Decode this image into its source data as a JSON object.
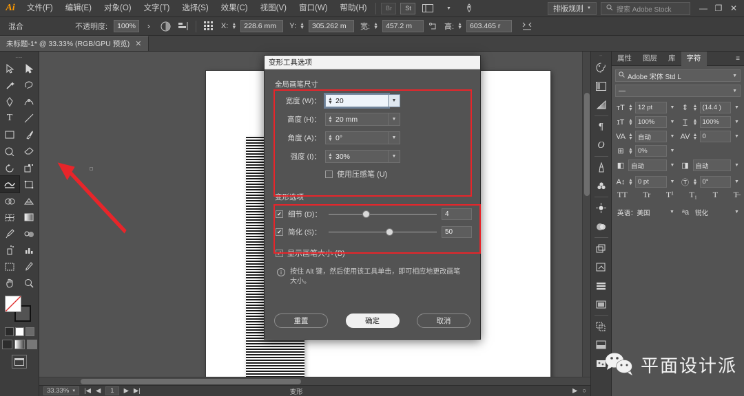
{
  "menubar": {
    "logo": "Ai",
    "items": [
      {
        "label": "文件(F)"
      },
      {
        "label": "编辑(E)"
      },
      {
        "label": "对象(O)"
      },
      {
        "label": "文字(T)"
      },
      {
        "label": "选择(S)"
      },
      {
        "label": "效果(C)"
      },
      {
        "label": "视图(V)"
      },
      {
        "label": "窗口(W)"
      },
      {
        "label": "帮助(H)"
      }
    ],
    "bridge_badge": "Br",
    "stock_badge": "St",
    "library_icon": "library-icon",
    "rocket_icon": "rocket-icon",
    "workspace": "排版规则",
    "search_placeholder": "搜索 Adobe Stock",
    "minimize": "—",
    "maximize": "❐",
    "close": "✕"
  },
  "controlbar": {
    "mode_label": "混合",
    "opacity_label": "不透明度:",
    "opacity_value": "100%",
    "arrow": "›",
    "transparency_icon": "transparency-icon",
    "align_icon": "align-icon",
    "anchor_icon": "anchor-reference-icon",
    "x_label": "X:",
    "x_value": "228.6 mm",
    "y_label": "Y:",
    "y_value": "305.262 m",
    "w_label": "宽:",
    "w_value": "457.2 m",
    "lock_icon": "link-ratio-icon",
    "h_label": "高:",
    "h_value": "603.465 r",
    "transform_icon": "transform-icon"
  },
  "doctab": {
    "title": "未标题-1* @ 33.33% (RGB/GPU 预览)",
    "close": "✕"
  },
  "toolbar": {
    "tools": [
      {
        "name": "selection-tool"
      },
      {
        "name": "direct-selection-tool"
      },
      {
        "name": "magic-wand-tool"
      },
      {
        "name": "lasso-tool"
      },
      {
        "name": "pen-tool"
      },
      {
        "name": "curvature-tool"
      },
      {
        "name": "type-tool"
      },
      {
        "name": "line-segment-tool"
      },
      {
        "name": "rectangle-tool"
      },
      {
        "name": "paintbrush-tool"
      },
      {
        "name": "shaper-tool"
      },
      {
        "name": "eraser-tool"
      },
      {
        "name": "rotate-tool"
      },
      {
        "name": "scale-tool"
      },
      {
        "name": "warp-tool"
      },
      {
        "name": "free-transform-tool"
      },
      {
        "name": "shape-builder-tool"
      },
      {
        "name": "perspective-grid-tool"
      },
      {
        "name": "mesh-tool"
      },
      {
        "name": "gradient-tool"
      },
      {
        "name": "eyedropper-tool"
      },
      {
        "name": "blend-tool"
      },
      {
        "name": "symbol-sprayer-tool"
      },
      {
        "name": "column-graph-tool"
      },
      {
        "name": "artboard-tool"
      },
      {
        "name": "slice-tool"
      },
      {
        "name": "hand-tool"
      },
      {
        "name": "zoom-tool"
      }
    ],
    "active_tool": "warp-tool",
    "fill_color": "#ffffff",
    "stroke_color": "#000000",
    "screen_mode": "screen-mode-icon"
  },
  "canvas": {
    "artboard_bg": "#ffffff",
    "stripe_dark": "#1a1a1a",
    "annotation_color": "#e8252a"
  },
  "statusbar": {
    "zoom": "33.33%",
    "nav_first": "|◀",
    "nav_prev": "◀",
    "page_value": "1",
    "nav_next": "▶",
    "nav_last": "▶|",
    "tool_label": "变形",
    "play": "▶",
    "circle": "○"
  },
  "rail": {
    "icons": [
      {
        "name": "color-panel-icon"
      },
      {
        "name": "color-guide-icon"
      },
      {
        "name": "gradient-panel-icon"
      },
      {
        "name": "paragraph-panel-icon"
      },
      {
        "name": "opentype-panel-icon"
      },
      {
        "name": "brushes-panel-icon"
      },
      {
        "name": "symbols-panel-icon"
      },
      {
        "name": "appearance-panel-icon"
      },
      {
        "name": "graphic-styles-icon"
      },
      {
        "name": "layers-panel-icon"
      },
      {
        "name": "artboards-panel-icon"
      },
      {
        "name": "align-panel-icon"
      },
      {
        "name": "transform-panel-icon"
      },
      {
        "name": "pathfinder-panel-icon"
      },
      {
        "name": "transparency-panel-icon"
      },
      {
        "name": "image-trace-icon"
      }
    ]
  },
  "dock": {
    "tabs": [
      {
        "label": "属性",
        "active": false
      },
      {
        "label": "图层",
        "active": false
      },
      {
        "label": "库",
        "active": false
      },
      {
        "label": "字符",
        "active": true
      }
    ],
    "menu_icon": "panel-menu-icon",
    "font_family": "Adobe 宋体 Std L",
    "font_style": "—",
    "font_size_icon": "font-size-icon",
    "font_size": "12 pt",
    "leading_icon": "leading-icon",
    "leading": "(14.4 )",
    "vscale_icon": "vertical-scale-icon",
    "vscale": "100%",
    "hscale_icon": "horizontal-scale-icon",
    "hscale": "100%",
    "kerning_icon": "kerning-icon",
    "kerning": "自动",
    "tracking_icon": "tracking-icon",
    "tracking": "0",
    "tsume_icon": "tsume-icon",
    "tsume": "0%",
    "left_aki_icon": "left-aki-icon",
    "left_aki": "自动",
    "right_aki_icon": "right-aki-icon",
    "right_aki": "自动",
    "baseline_icon": "baseline-shift-icon",
    "baseline": "0 pt",
    "rotation_icon": "character-rotation-icon",
    "rotation": "0°",
    "style_buttons": [
      "TT",
      "Tr",
      "T¹",
      "T₁",
      "T",
      "T̶"
    ],
    "lang_label": "英语：美国",
    "antialias_icon": "anti-aliasing-icon",
    "antialias": "锐化"
  },
  "dialog": {
    "title": "变形工具选项",
    "section1_title": "全局画笔尺寸",
    "fields": [
      {
        "label": "宽度 (W)：",
        "value": "20",
        "focused": true
      },
      {
        "label": "高度 (H)：",
        "value": "20 mm",
        "focused": false
      },
      {
        "label": "角度 (A)：",
        "value": "0°",
        "focused": false
      },
      {
        "label": "强度 (I)：",
        "value": "30%",
        "focused": false
      }
    ],
    "pressure_pen_label": "使用压感笔 (U)",
    "pressure_pen_checked": false,
    "section2_title": "变形选项",
    "sliders": [
      {
        "label": "细节 (D)：",
        "value": "4",
        "checked": true,
        "pos_pct": 31
      },
      {
        "label": "简化 (S)：",
        "value": "50",
        "checked": true,
        "pos_pct": 53
      }
    ],
    "show_brush_label": "显示画笔大小 (B)",
    "show_brush_checked": true,
    "note_icon": "info-icon",
    "note_text": "按住 Alt 键，然后使用该工具单击，即可相应地更改画笔大小。",
    "buttons": {
      "reset": "重置",
      "ok": "确定",
      "cancel": "取消"
    }
  },
  "watermark": {
    "icon": "wechat-icon",
    "text": "平面设计派"
  }
}
